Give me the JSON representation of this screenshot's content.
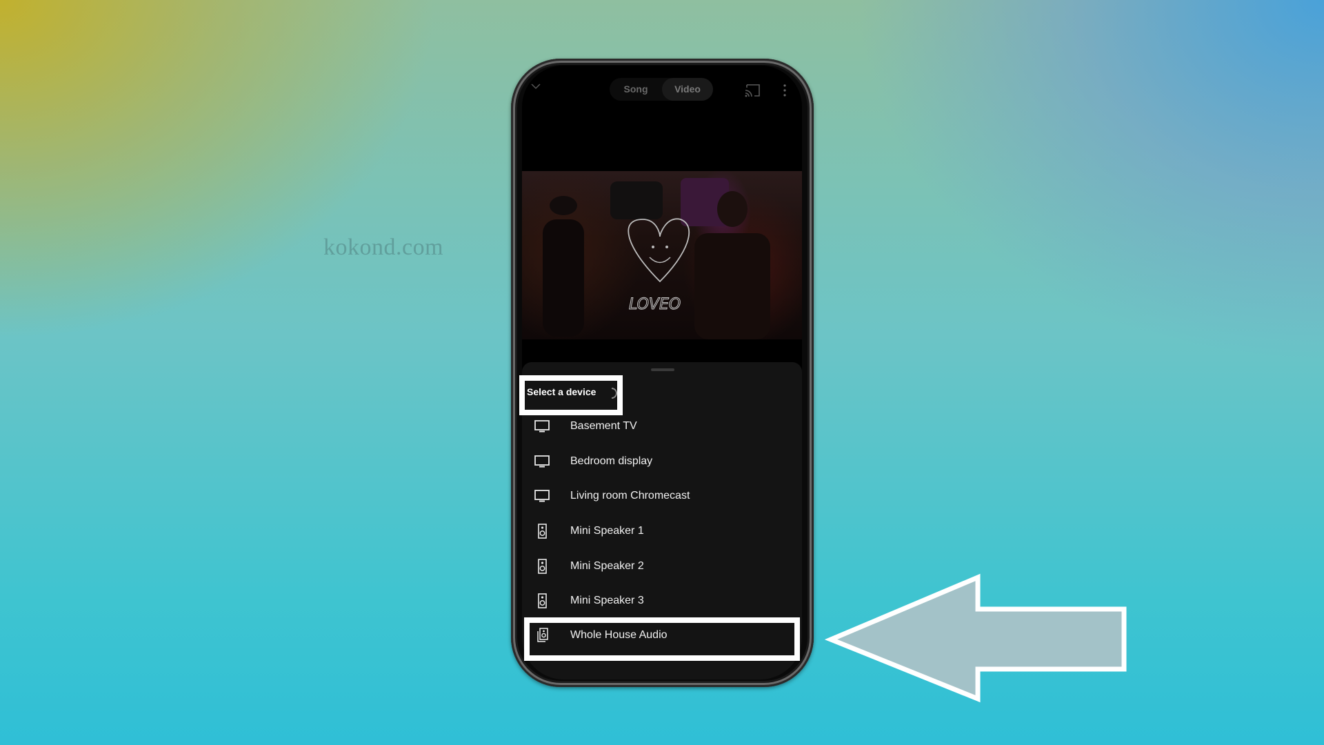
{
  "watermark": "kokond.com",
  "topbar": {
    "collapse_icon": "chevron-down-icon",
    "tabs": [
      {
        "label": "Song",
        "selected": false
      },
      {
        "label": "Video",
        "selected": true
      }
    ],
    "cast_icon": "cast-icon",
    "more_icon": "more-vertical-icon"
  },
  "video": {
    "overlay_text": "LOVEO"
  },
  "sheet": {
    "title": "Select a device",
    "loading": true,
    "devices": [
      {
        "label": "Basement TV",
        "icon": "tv-icon"
      },
      {
        "label": "Bedroom display",
        "icon": "tv-icon"
      },
      {
        "label": "Living room Chromecast",
        "icon": "tv-icon"
      },
      {
        "label": "Mini Speaker 1",
        "icon": "speaker-icon"
      },
      {
        "label": "Mini Speaker 2",
        "icon": "speaker-icon"
      },
      {
        "label": "Mini Speaker 3",
        "icon": "speaker-icon"
      },
      {
        "label": "Whole House Audio",
        "icon": "speaker-group-icon",
        "highlighted": true
      }
    ]
  },
  "annotation": {
    "arrow_direction": "left",
    "arrow_fill": "#a3c2c8",
    "highlight_color": "#ffffff"
  }
}
